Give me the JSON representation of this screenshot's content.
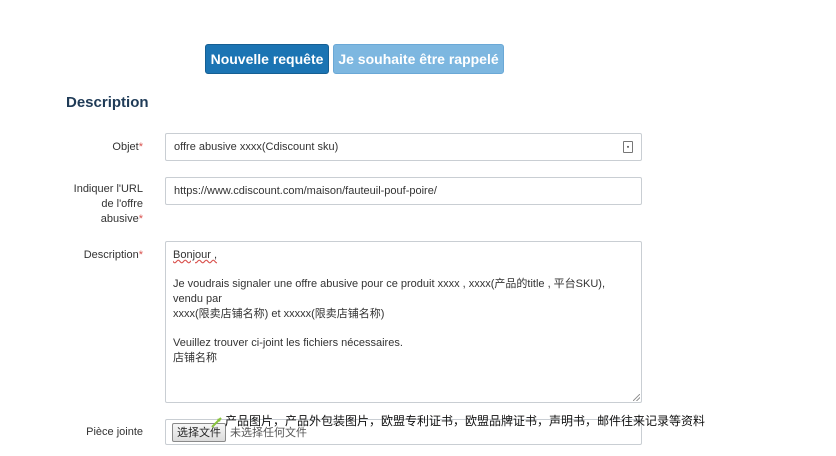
{
  "actions": {
    "new_request": "Nouvelle requête",
    "call_back": "Je souhaite être rappelé"
  },
  "section": {
    "title": "Description"
  },
  "form": {
    "objet": {
      "label": "Objet",
      "required_mark": "*",
      "value": "offre abusive xxxx(Cdiscount sku)"
    },
    "url": {
      "label_1": "Indiquer l'URL",
      "label_2": "de l'offre",
      "label_3": "abusive",
      "required_mark": "*",
      "value": "https://www.cdiscount.com/maison/fauteuil-pouf-poire/"
    },
    "description": {
      "label": "Description",
      "required_mark": "*",
      "line_1": "Bonjour ,",
      "line_2": "Je voudrais signaler une offre abusive pour ce produit xxxx , xxxx(产品的title , 平台SKU), vendu par",
      "line_3": "xxxx(限卖店铺名称) et xxxxx(限卖店铺名称)",
      "line_4": "Veuillez trouver ci-joint les fichiers nécessaires.",
      "line_5": "店铺名称"
    },
    "attachment": {
      "label": "Pièce jointe",
      "button_label": "选择文件",
      "status": "未选择任何文件"
    }
  },
  "annotation": {
    "text": "产品图片，产品外包装图片，欧盟专利证书，欧盟品牌证书，声明书，邮件往来记录等资料"
  },
  "colors": {
    "primary": "#1b74b3",
    "secondary": "#7db7e0",
    "required": "#d9534f",
    "heading": "#1f3b57"
  }
}
